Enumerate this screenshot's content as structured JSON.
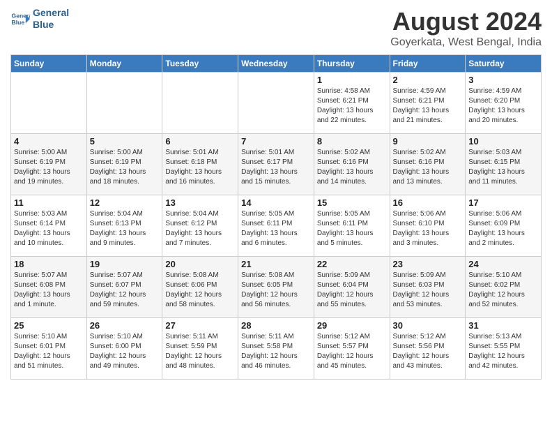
{
  "header": {
    "logo_line1": "General",
    "logo_line2": "Blue",
    "title": "August 2024",
    "location": "Goyerkata, West Bengal, India"
  },
  "days_of_week": [
    "Sunday",
    "Monday",
    "Tuesday",
    "Wednesday",
    "Thursday",
    "Friday",
    "Saturday"
  ],
  "weeks": [
    [
      {
        "day": "",
        "info": ""
      },
      {
        "day": "",
        "info": ""
      },
      {
        "day": "",
        "info": ""
      },
      {
        "day": "",
        "info": ""
      },
      {
        "day": "1",
        "info": "Sunrise: 4:58 AM\nSunset: 6:21 PM\nDaylight: 13 hours\nand 22 minutes."
      },
      {
        "day": "2",
        "info": "Sunrise: 4:59 AM\nSunset: 6:21 PM\nDaylight: 13 hours\nand 21 minutes."
      },
      {
        "day": "3",
        "info": "Sunrise: 4:59 AM\nSunset: 6:20 PM\nDaylight: 13 hours\nand 20 minutes."
      }
    ],
    [
      {
        "day": "4",
        "info": "Sunrise: 5:00 AM\nSunset: 6:19 PM\nDaylight: 13 hours\nand 19 minutes."
      },
      {
        "day": "5",
        "info": "Sunrise: 5:00 AM\nSunset: 6:19 PM\nDaylight: 13 hours\nand 18 minutes."
      },
      {
        "day": "6",
        "info": "Sunrise: 5:01 AM\nSunset: 6:18 PM\nDaylight: 13 hours\nand 16 minutes."
      },
      {
        "day": "7",
        "info": "Sunrise: 5:01 AM\nSunset: 6:17 PM\nDaylight: 13 hours\nand 15 minutes."
      },
      {
        "day": "8",
        "info": "Sunrise: 5:02 AM\nSunset: 6:16 PM\nDaylight: 13 hours\nand 14 minutes."
      },
      {
        "day": "9",
        "info": "Sunrise: 5:02 AM\nSunset: 6:16 PM\nDaylight: 13 hours\nand 13 minutes."
      },
      {
        "day": "10",
        "info": "Sunrise: 5:03 AM\nSunset: 6:15 PM\nDaylight: 13 hours\nand 11 minutes."
      }
    ],
    [
      {
        "day": "11",
        "info": "Sunrise: 5:03 AM\nSunset: 6:14 PM\nDaylight: 13 hours\nand 10 minutes."
      },
      {
        "day": "12",
        "info": "Sunrise: 5:04 AM\nSunset: 6:13 PM\nDaylight: 13 hours\nand 9 minutes."
      },
      {
        "day": "13",
        "info": "Sunrise: 5:04 AM\nSunset: 6:12 PM\nDaylight: 13 hours\nand 7 minutes."
      },
      {
        "day": "14",
        "info": "Sunrise: 5:05 AM\nSunset: 6:11 PM\nDaylight: 13 hours\nand 6 minutes."
      },
      {
        "day": "15",
        "info": "Sunrise: 5:05 AM\nSunset: 6:11 PM\nDaylight: 13 hours\nand 5 minutes."
      },
      {
        "day": "16",
        "info": "Sunrise: 5:06 AM\nSunset: 6:10 PM\nDaylight: 13 hours\nand 3 minutes."
      },
      {
        "day": "17",
        "info": "Sunrise: 5:06 AM\nSunset: 6:09 PM\nDaylight: 13 hours\nand 2 minutes."
      }
    ],
    [
      {
        "day": "18",
        "info": "Sunrise: 5:07 AM\nSunset: 6:08 PM\nDaylight: 13 hours\nand 1 minute."
      },
      {
        "day": "19",
        "info": "Sunrise: 5:07 AM\nSunset: 6:07 PM\nDaylight: 12 hours\nand 59 minutes."
      },
      {
        "day": "20",
        "info": "Sunrise: 5:08 AM\nSunset: 6:06 PM\nDaylight: 12 hours\nand 58 minutes."
      },
      {
        "day": "21",
        "info": "Sunrise: 5:08 AM\nSunset: 6:05 PM\nDaylight: 12 hours\nand 56 minutes."
      },
      {
        "day": "22",
        "info": "Sunrise: 5:09 AM\nSunset: 6:04 PM\nDaylight: 12 hours\nand 55 minutes."
      },
      {
        "day": "23",
        "info": "Sunrise: 5:09 AM\nSunset: 6:03 PM\nDaylight: 12 hours\nand 53 minutes."
      },
      {
        "day": "24",
        "info": "Sunrise: 5:10 AM\nSunset: 6:02 PM\nDaylight: 12 hours\nand 52 minutes."
      }
    ],
    [
      {
        "day": "25",
        "info": "Sunrise: 5:10 AM\nSunset: 6:01 PM\nDaylight: 12 hours\nand 51 minutes."
      },
      {
        "day": "26",
        "info": "Sunrise: 5:10 AM\nSunset: 6:00 PM\nDaylight: 12 hours\nand 49 minutes."
      },
      {
        "day": "27",
        "info": "Sunrise: 5:11 AM\nSunset: 5:59 PM\nDaylight: 12 hours\nand 48 minutes."
      },
      {
        "day": "28",
        "info": "Sunrise: 5:11 AM\nSunset: 5:58 PM\nDaylight: 12 hours\nand 46 minutes."
      },
      {
        "day": "29",
        "info": "Sunrise: 5:12 AM\nSunset: 5:57 PM\nDaylight: 12 hours\nand 45 minutes."
      },
      {
        "day": "30",
        "info": "Sunrise: 5:12 AM\nSunset: 5:56 PM\nDaylight: 12 hours\nand 43 minutes."
      },
      {
        "day": "31",
        "info": "Sunrise: 5:13 AM\nSunset: 5:55 PM\nDaylight: 12 hours\nand 42 minutes."
      }
    ]
  ]
}
